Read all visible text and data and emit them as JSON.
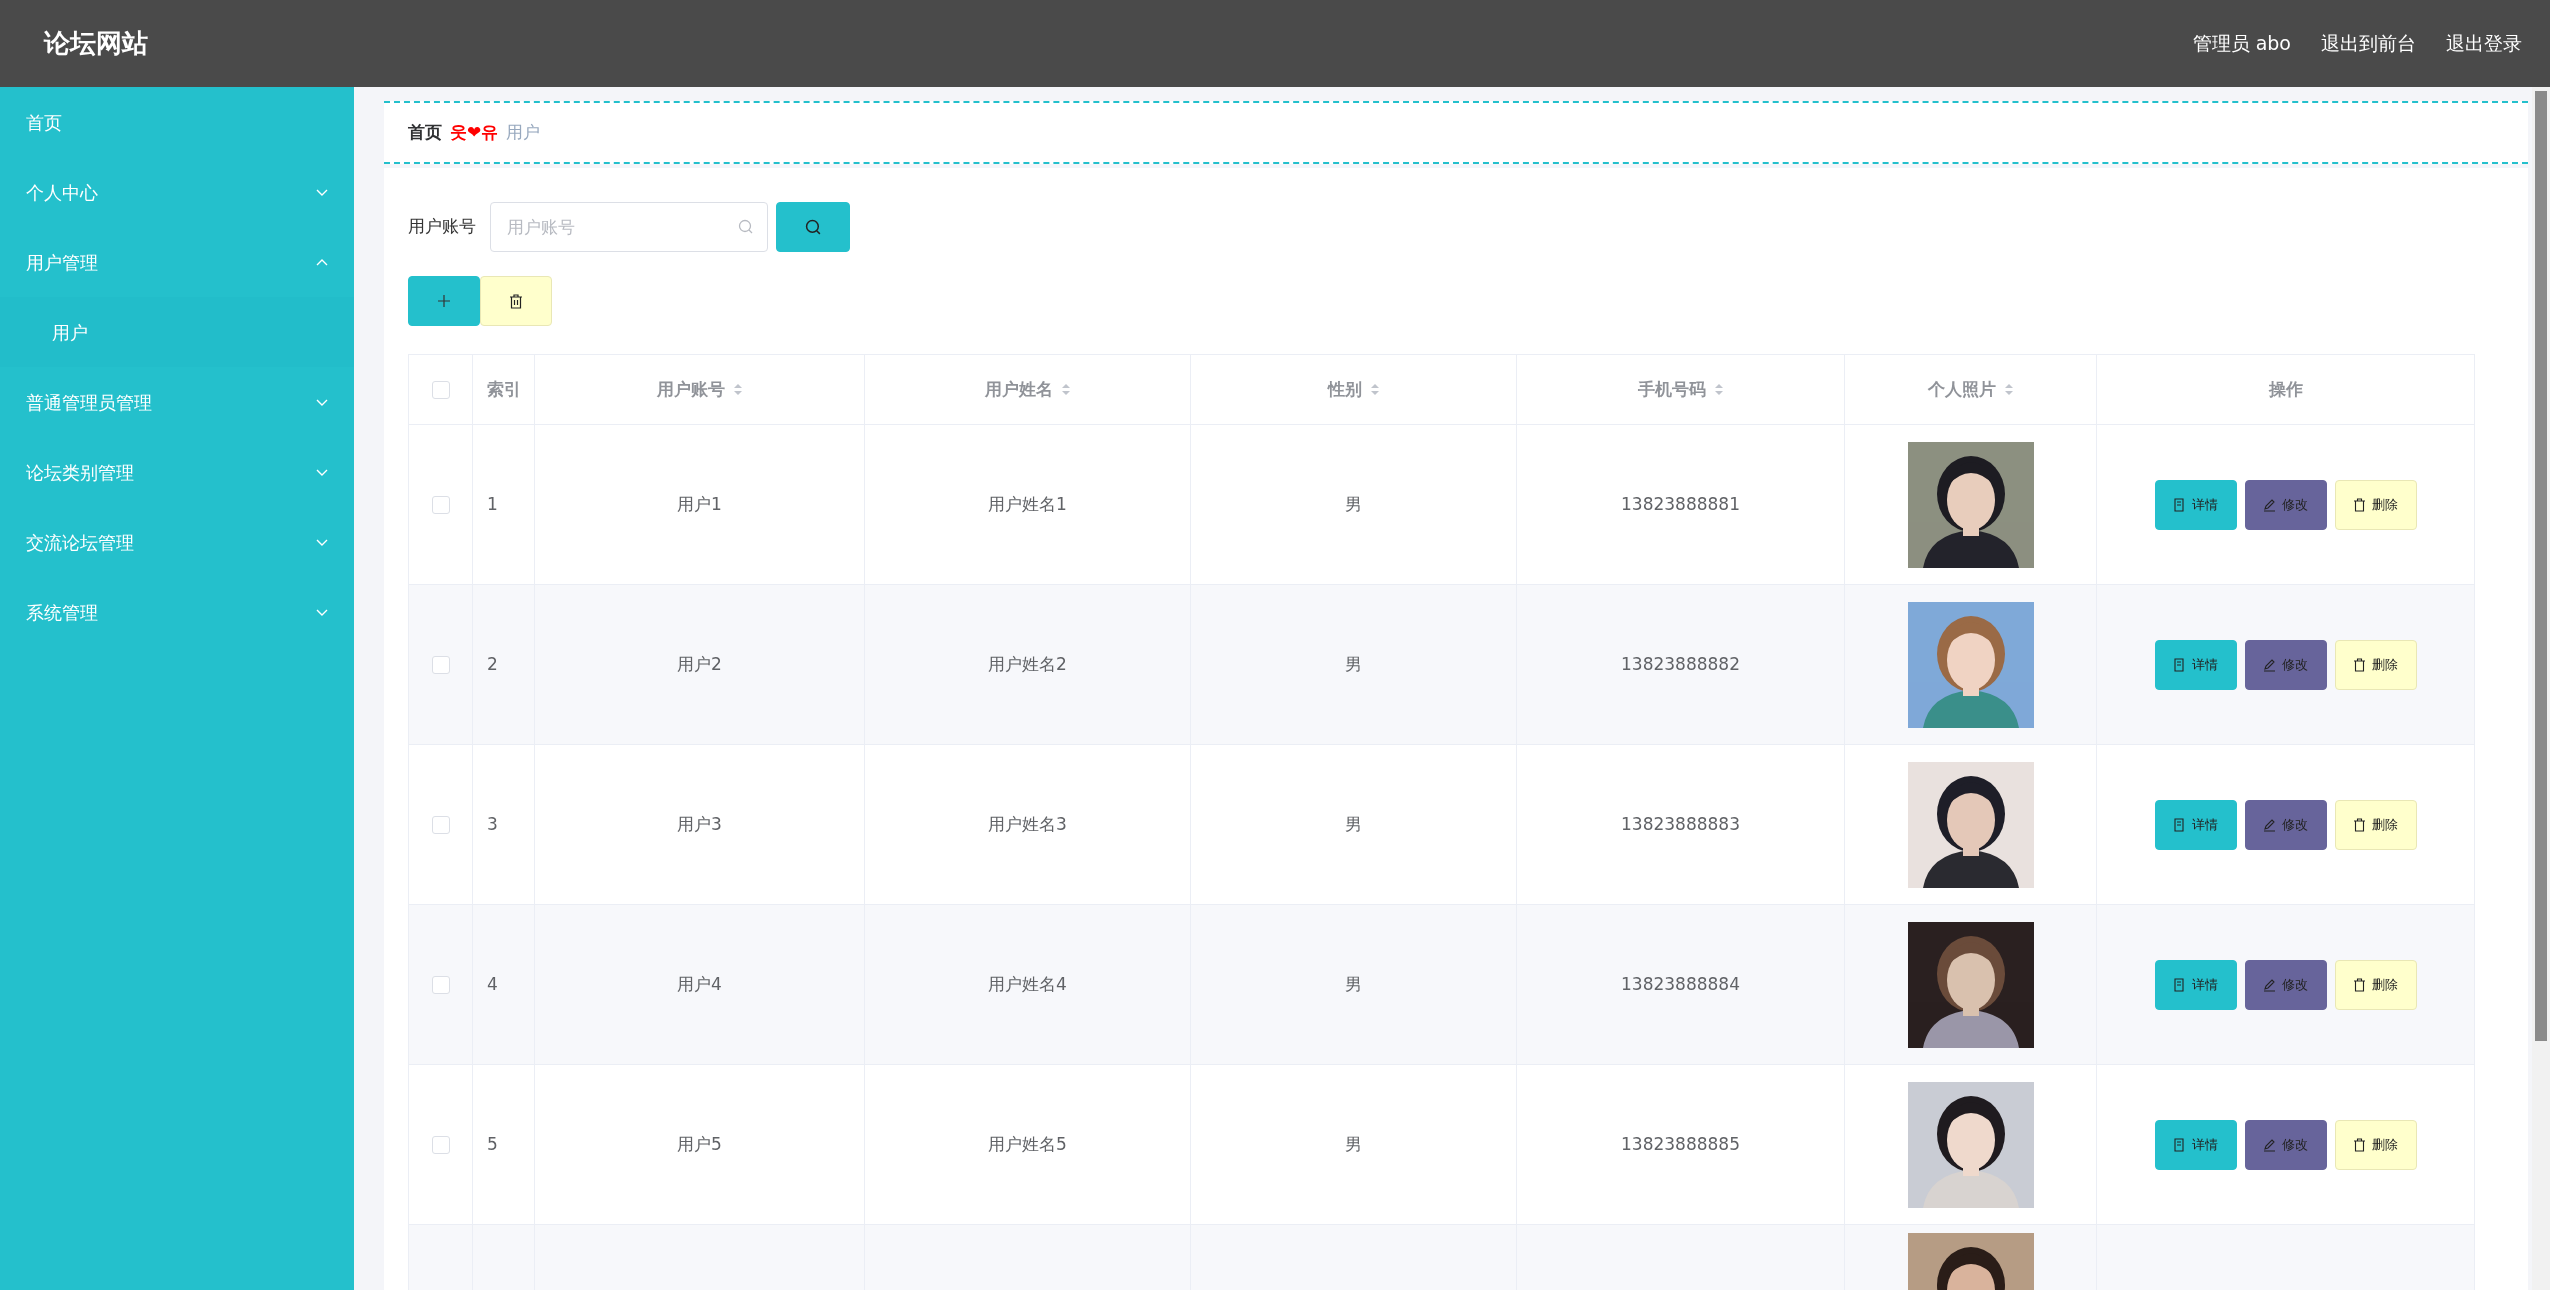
{
  "header": {
    "title": "论坛网站",
    "links": [
      "管理员 abo",
      "退出到前台",
      "退出登录"
    ]
  },
  "sidebar": {
    "items": [
      {
        "label": "首页",
        "kind": "link"
      },
      {
        "label": "个人中心",
        "kind": "group",
        "expanded": false
      },
      {
        "label": "用户管理",
        "kind": "group",
        "expanded": true,
        "children": [
          {
            "label": "用户"
          }
        ]
      },
      {
        "label": "普通管理员管理",
        "kind": "group",
        "expanded": false
      },
      {
        "label": "论坛类别管理",
        "kind": "group",
        "expanded": false
      },
      {
        "label": "交流论坛管理",
        "kind": "group",
        "expanded": false
      },
      {
        "label": "系统管理",
        "kind": "group",
        "expanded": false
      }
    ]
  },
  "breadcrumb": {
    "home": "首页",
    "separator": "웃❤유",
    "current": "用户"
  },
  "search": {
    "label": "用户账号",
    "placeholder": "用户账号"
  },
  "table": {
    "select_all": {
      "checked": false
    },
    "columns": [
      {
        "label": "索引",
        "sortable": false
      },
      {
        "label": "用户账号",
        "sortable": true
      },
      {
        "label": "用户姓名",
        "sortable": true
      },
      {
        "label": "性别",
        "sortable": true
      },
      {
        "label": "手机号码",
        "sortable": true
      },
      {
        "label": "个人照片",
        "sortable": true
      },
      {
        "label": "操作",
        "sortable": false
      }
    ],
    "rows": [
      {
        "kind": "full",
        "selected": false,
        "index": "1",
        "account": "用户1",
        "name": "用户姓名1",
        "gender": "男",
        "phone": "13823888881",
        "actions": [
          "详情",
          "修改",
          "删除"
        ]
      },
      {
        "kind": "full",
        "selected": false,
        "index": "2",
        "account": "用户2",
        "name": "用户姓名2",
        "gender": "男",
        "phone": "13823888882",
        "actions": [
          "详情",
          "修改",
          "删除"
        ]
      },
      {
        "kind": "full",
        "selected": false,
        "index": "3",
        "account": "用户3",
        "name": "用户姓名3",
        "gender": "男",
        "phone": "13823888883",
        "actions": [
          "详情",
          "修改",
          "删除"
        ]
      },
      {
        "kind": "full",
        "selected": false,
        "index": "4",
        "account": "用户4",
        "name": "用户姓名4",
        "gender": "男",
        "phone": "13823888884",
        "actions": [
          "详情",
          "修改",
          "删除"
        ]
      },
      {
        "kind": "full",
        "selected": false,
        "index": "5",
        "account": "用户5",
        "name": "用户姓名5",
        "gender": "男",
        "phone": "13823888885",
        "actions": [
          "详情",
          "修改",
          "删除"
        ]
      },
      {
        "kind": "partial"
      }
    ]
  }
}
